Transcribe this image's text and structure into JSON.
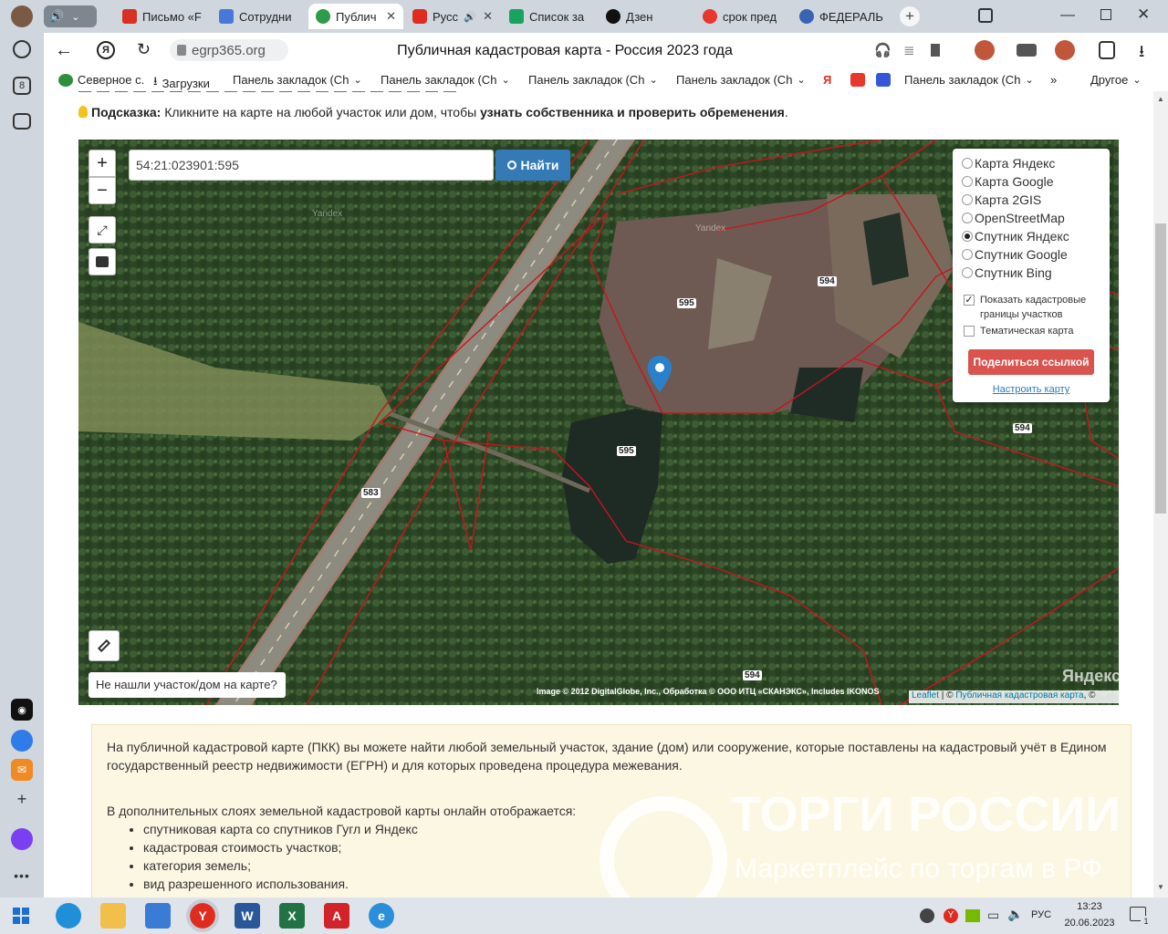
{
  "tabs": [
    {
      "label": "Письмо «F",
      "color": "#d93025"
    },
    {
      "label": "Сотрудни",
      "color": "#4a78d8"
    },
    {
      "label": "Публич",
      "color": "#2e9b48",
      "active": true
    },
    {
      "label": "Русс",
      "color": "#e02b20"
    },
    {
      "label": "Список за",
      "color": "#1aa260"
    },
    {
      "label": "Дзен",
      "color": "#111111"
    },
    {
      "label": "срок пред",
      "color": "#e8372c"
    },
    {
      "label": "ФЕДЕРАЛЬ",
      "color": "#3b63b5"
    }
  ],
  "address": {
    "url": "egrp365.org",
    "page_title": "Публичная кадастровая карта - Россия 2023 года"
  },
  "bookmarks": [
    {
      "label": "Северное с."
    },
    {
      "label": "Загрузки"
    },
    {
      "label": "Панель закладок (Ch"
    },
    {
      "label": "Панель закладок (Ch"
    },
    {
      "label": "Панель закладок (Ch"
    },
    {
      "label": "Панель закладок (Ch"
    },
    {
      "label": "Панель закладок (Ch"
    },
    {
      "label": "Другое"
    }
  ],
  "hint": {
    "prefix": "Подсказка:",
    "text": "Кликните на карте на любой участок или дом, чтобы ",
    "bold": "узнать собственника и проверить обременения",
    "suffix": "."
  },
  "map": {
    "search_value": "54:21:023901:595",
    "search_button": "Найти",
    "zoom_in": "+",
    "zoom_out": "−",
    "not_found": "Не нашли участок/дом на карте?",
    "layers": [
      {
        "label": "Карта Яндекс",
        "selected": false
      },
      {
        "label": "Карта Google",
        "selected": false
      },
      {
        "label": "Карта 2GIS",
        "selected": false
      },
      {
        "label": "OpenStreetMap",
        "selected": false
      },
      {
        "label": "Спутник Яндекс",
        "selected": true
      },
      {
        "label": "Спутник Google",
        "selected": false
      },
      {
        "label": "Спутник Bing",
        "selected": false
      }
    ],
    "show_borders": "Показать кадастровые границы участков",
    "thematic": "Тематическая карта",
    "share_button": "Поделиться ссылкой",
    "configure_link": "Настроить карту",
    "parcel_labels": [
      "595",
      "595",
      "594",
      "594",
      "594",
      "583"
    ],
    "attribution": "Image © 2012 DigitalGlobe, Inc., Обработка © ООО ИТЦ «СКАНЭКС», Includes IKONOS",
    "leaflet": "Leaflet",
    "pkk_link": "Публичная кадастровая карта",
    "yandex_logo": "Яндекс",
    "yandex_wm": "Yandex"
  },
  "info": {
    "para1": "На публичной кадастровой карте (ПКК) вы можете найти любой земельный участок, здание (дом) или сооружение, которые поставлены на кадастровый учёт в Едином государственный реестр недвижимости (ЕГРН) и для которых проведена процедура межевания.",
    "para2": "В дополнительных слоях земельной кадастровой карты онлайн отображается:",
    "bullets": [
      "спутниковая карта со спутников Гугл и Яндекс",
      "кадастровая стоимость участков;",
      "категория земель;",
      "вид разрешенного использования."
    ],
    "watermark_title": "ТОРГИ РОССИИ",
    "watermark_sub": "Маркетплейс по торгам в РФ"
  },
  "taskbar": {
    "lang": "РУС",
    "time": "13:23",
    "date": "20.06.2023",
    "notifications": "1"
  }
}
